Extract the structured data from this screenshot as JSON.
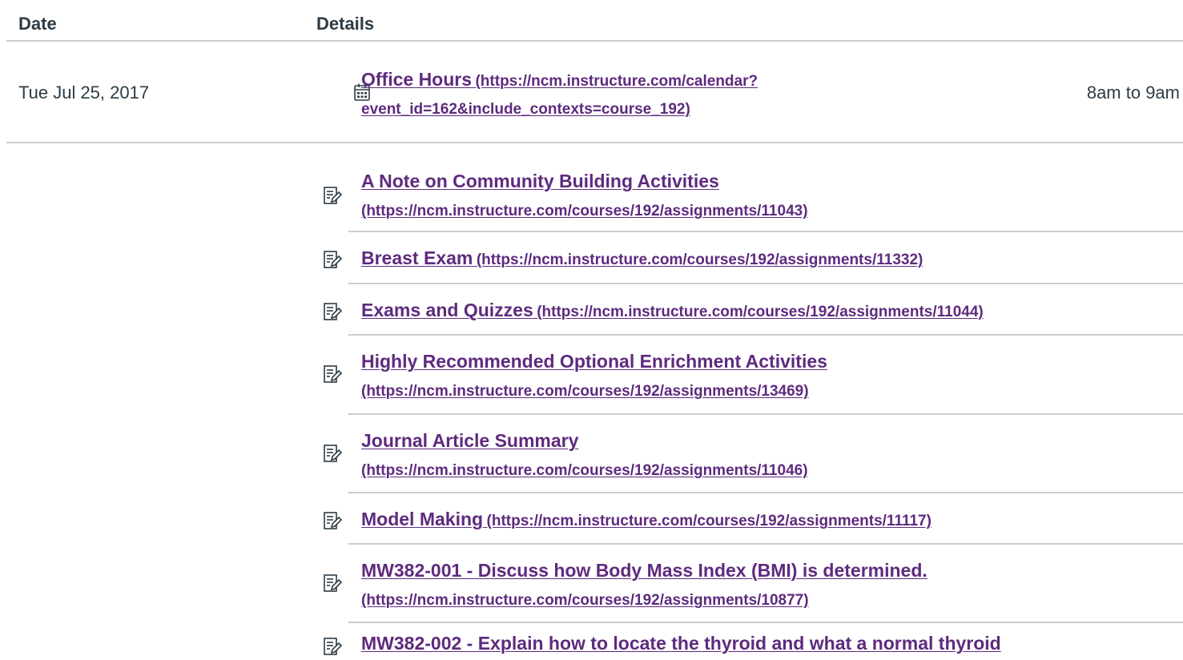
{
  "table": {
    "headers": {
      "date": "Date",
      "details": "Details"
    }
  },
  "office_event": {
    "date": "Tue Jul 25, 2017",
    "icon": "calendar-icon",
    "title": "Office Hours",
    "url_line1": "(https://ncm.instructure.com/calendar?",
    "url_line2": "event_id=162&include_contexts=course_192)",
    "time": "8am to 9am"
  },
  "assignments": [
    {
      "icon": "assignment-icon",
      "title": "A Note on Community Building Activities",
      "url": "(https://ncm.instructure.com/courses/192/assignments/11043)"
    },
    {
      "icon": "assignment-icon",
      "title": "Breast Exam",
      "url": "(https://ncm.instructure.com/courses/192/assignments/11332)"
    },
    {
      "icon": "assignment-icon",
      "title": "Exams and Quizzes",
      "url": "(https://ncm.instructure.com/courses/192/assignments/11044)"
    },
    {
      "icon": "assignment-icon",
      "title": "Highly Recommended Optional Enrichment Activities",
      "url": "(https://ncm.instructure.com/courses/192/assignments/13469)"
    },
    {
      "icon": "assignment-icon",
      "title": "Journal Article Summary",
      "url": "(https://ncm.instructure.com/courses/192/assignments/11046)"
    },
    {
      "icon": "assignment-icon",
      "title": "Model Making",
      "url": "(https://ncm.instructure.com/courses/192/assignments/11117)"
    },
    {
      "icon": "assignment-icon",
      "title": "MW382-001 - Discuss how Body Mass Index (BMI) is determined.",
      "url": "(https://ncm.instructure.com/courses/192/assignments/10877)"
    },
    {
      "icon": "assignment-icon",
      "title": "MW382-002 - Explain how to locate the thyroid and what a normal thyroid",
      "url": ""
    }
  ],
  "colors": {
    "link": "#5e2a7e",
    "text": "#2d3b45",
    "divider": "#c7cdd1"
  }
}
